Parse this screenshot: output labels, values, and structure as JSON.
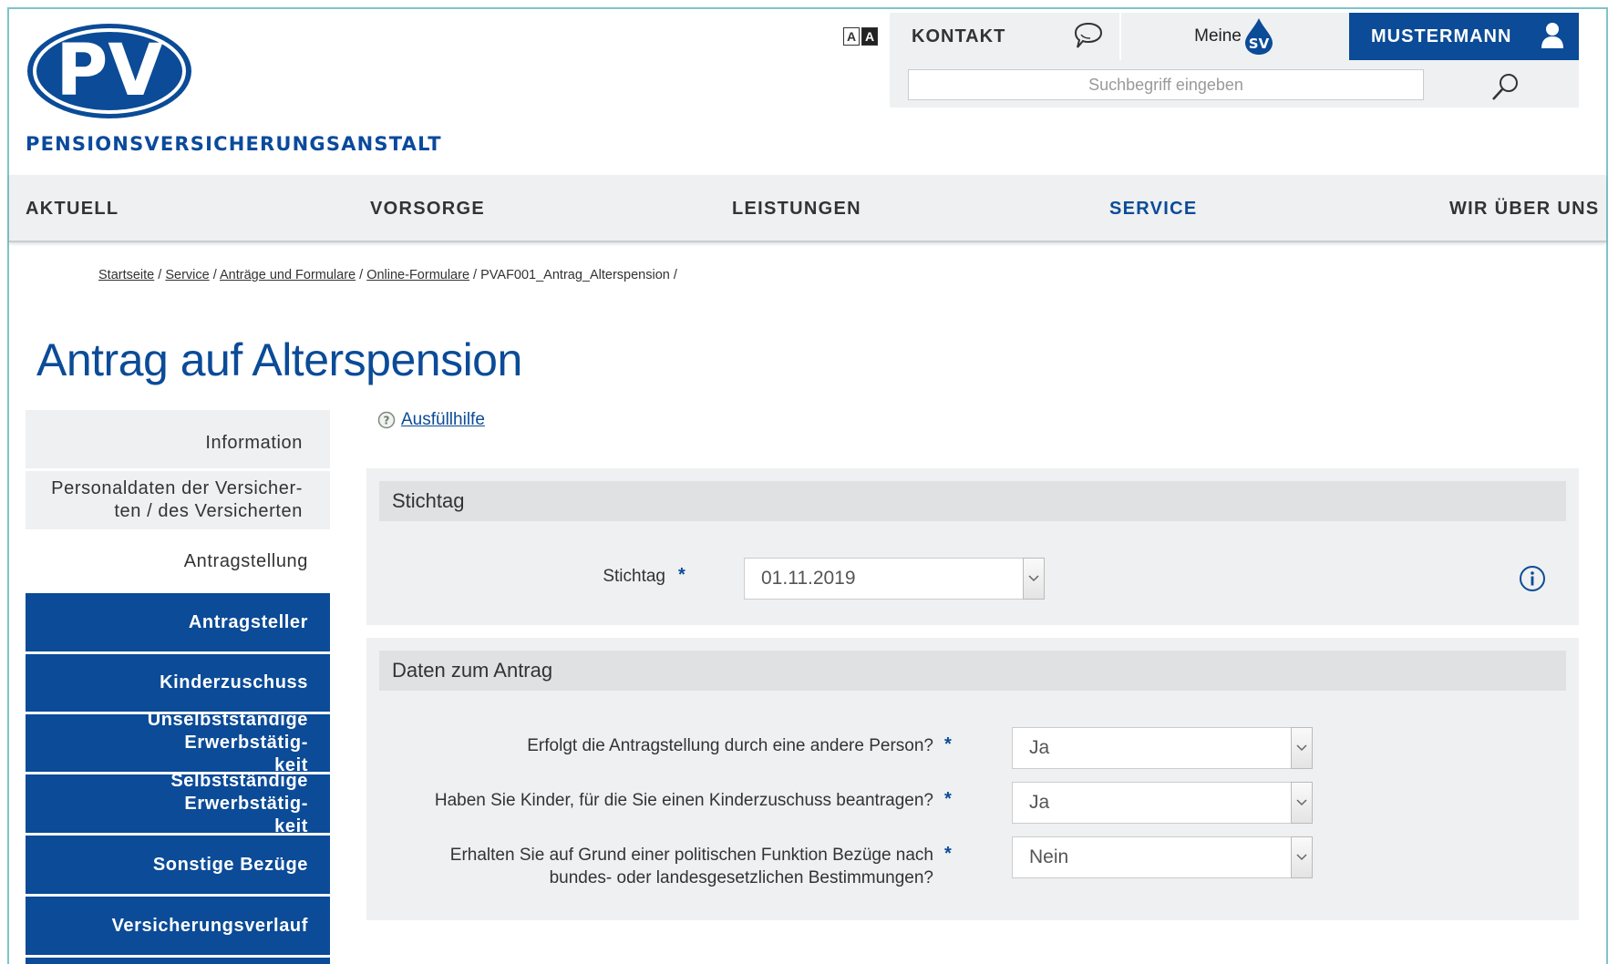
{
  "header": {
    "brand": "PENSIONSVERSICHERUNGSANSTALT",
    "logo_text": "PV",
    "font_size_toggle": [
      "A",
      "A"
    ],
    "kontakt": "KONTAKT",
    "meine_label": "Meine",
    "meine_badge": "SV",
    "user": "MUSTERMANN",
    "search_placeholder": "Suchbegriff eingeben"
  },
  "nav": {
    "items": [
      "AKTUELL",
      "VORSORGE",
      "LEISTUNGEN",
      "SERVICE",
      "WIR ÜBER UNS"
    ],
    "active": "SERVICE"
  },
  "breadcrumb": {
    "items": [
      "Startseite",
      "Service",
      "Anträge und Formulare",
      "Online-Formulare",
      "PVAF001_Antrag_Alterspension"
    ]
  },
  "page": {
    "title": "Antrag auf Alterspension"
  },
  "sidebar": {
    "items": [
      {
        "label": "Information",
        "style": "grey"
      },
      {
        "label": "Personaldaten der Versicher-\nten / des Versicherten",
        "style": "grey"
      },
      {
        "label": "Antragstellung",
        "style": "plain"
      },
      {
        "label": "Antragsteller",
        "style": "blue"
      },
      {
        "label": "Kinderzuschuss",
        "style": "blue"
      },
      {
        "label": "Unselbstständige Erwerbstätig-\nkeit",
        "style": "blue"
      },
      {
        "label": "Selbstständige Erwerbstätig-\nkeit",
        "style": "blue"
      },
      {
        "label": "Sonstige Bezüge",
        "style": "blue"
      },
      {
        "label": "Versicherungsverlauf",
        "style": "blue"
      }
    ]
  },
  "help": {
    "label": "Ausfüllhilfe"
  },
  "stichtag_panel": {
    "title": "Stichtag",
    "field_label": "Stichtag",
    "required": "*",
    "value": "01.11.2019"
  },
  "antrag_panel": {
    "title": "Daten zum Antrag",
    "required": "*",
    "questions": [
      {
        "label": "Erfolgt die Antragstellung durch eine andere Person?",
        "value": "Ja"
      },
      {
        "label": "Haben Sie Kinder, für die Sie einen Kinderzuschuss beantragen?",
        "value": "Ja"
      },
      {
        "label": "Erhalten Sie auf Grund einer politischen Funktion Bezüge nach\nbundes- oder landesgesetzlichen Bestimmungen?",
        "value": "Nein"
      }
    ]
  },
  "colors": {
    "brand_blue": "#0b4b97",
    "panel_grey": "#eef0f1",
    "panel_head_grey": "#dfe1e3"
  },
  "icons": {
    "kontakt": "speech-bubble-icon",
    "user": "user-icon",
    "search": "search-icon",
    "help": "question-circle-icon",
    "info": "info-circle-icon",
    "caret": "chevron-down-icon"
  }
}
